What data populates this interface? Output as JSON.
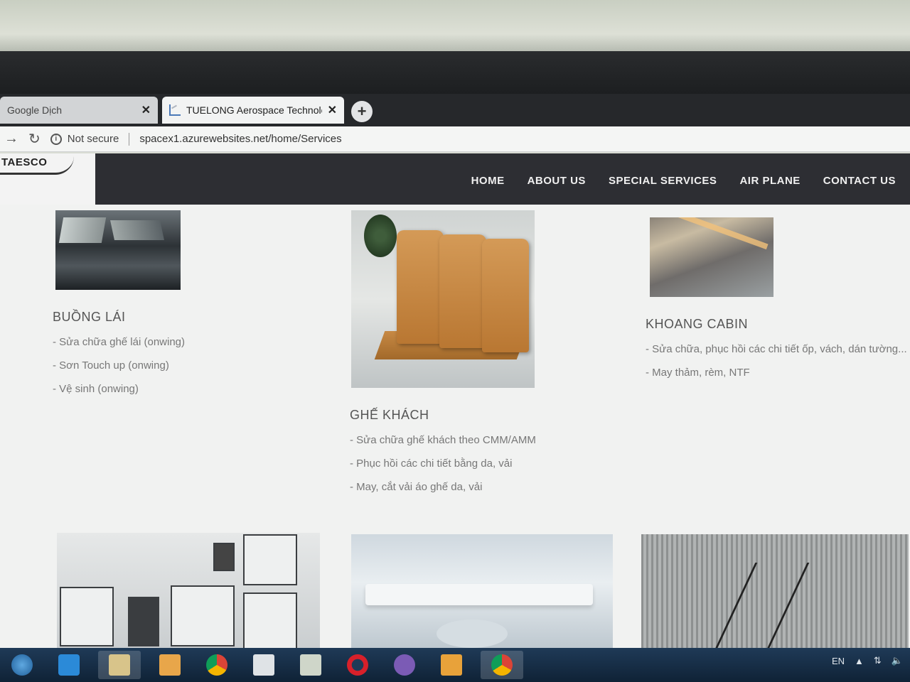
{
  "browser": {
    "tabs": [
      {
        "label": "Google Dịch",
        "active": false
      },
      {
        "label": "TUELONG Aerospace Technology",
        "active": true
      }
    ],
    "security_label": "Not secure",
    "url": "spacex1.azurewebsites.net/home/Services"
  },
  "site": {
    "logo_text": "TAESCO",
    "nav": [
      "HOME",
      "ABOUT US",
      "SPECIAL SERVICES",
      "AIR PLANE",
      "CONTACT US"
    ]
  },
  "services": [
    {
      "title": "BUỒNG LÁI",
      "items": [
        "- Sửa chữa ghế lái (onwing)",
        "- Sơn Touch up (onwing)",
        "- Vệ sinh (onwing)"
      ]
    },
    {
      "title": "GHẾ KHÁCH",
      "items": [
        "- Sửa chữa ghế khách theo CMM/AMM",
        "- Phục hồi các chi tiết bằng da, vải",
        "- May, cắt vải áo ghế da, vải"
      ]
    },
    {
      "title": "KHOANG CABIN",
      "items": [
        "- Sửa chữa, phục hồi các chi tiết ốp, vách, dán tường...",
        "- May thảm, rèm, NTF"
      ]
    }
  ],
  "taskbar": {
    "language": "EN",
    "apps": [
      "internet-explorer-icon",
      "file-explorer-icon",
      "media-player-icon",
      "chrome-icon",
      "notepad-icon",
      "calculator-icon",
      "opera-icon",
      "viber-icon",
      "outlook-icon",
      "chrome-active-icon"
    ]
  }
}
